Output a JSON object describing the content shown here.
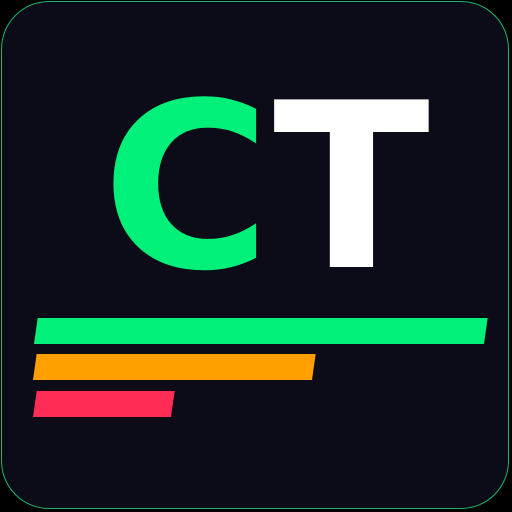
{
  "logo": {
    "letter_1": "C",
    "letter_2": "T",
    "letter_1_color": "#00f07a",
    "letter_2_color": "#ffffff"
  },
  "tile": {
    "background": "#0b0c17",
    "border_color": "#1db86a"
  },
  "bars": [
    {
      "name": "green",
      "color": "#00f07a"
    },
    {
      "name": "orange",
      "color": "#ffa000"
    },
    {
      "name": "red",
      "color": "#ff2d55"
    }
  ]
}
